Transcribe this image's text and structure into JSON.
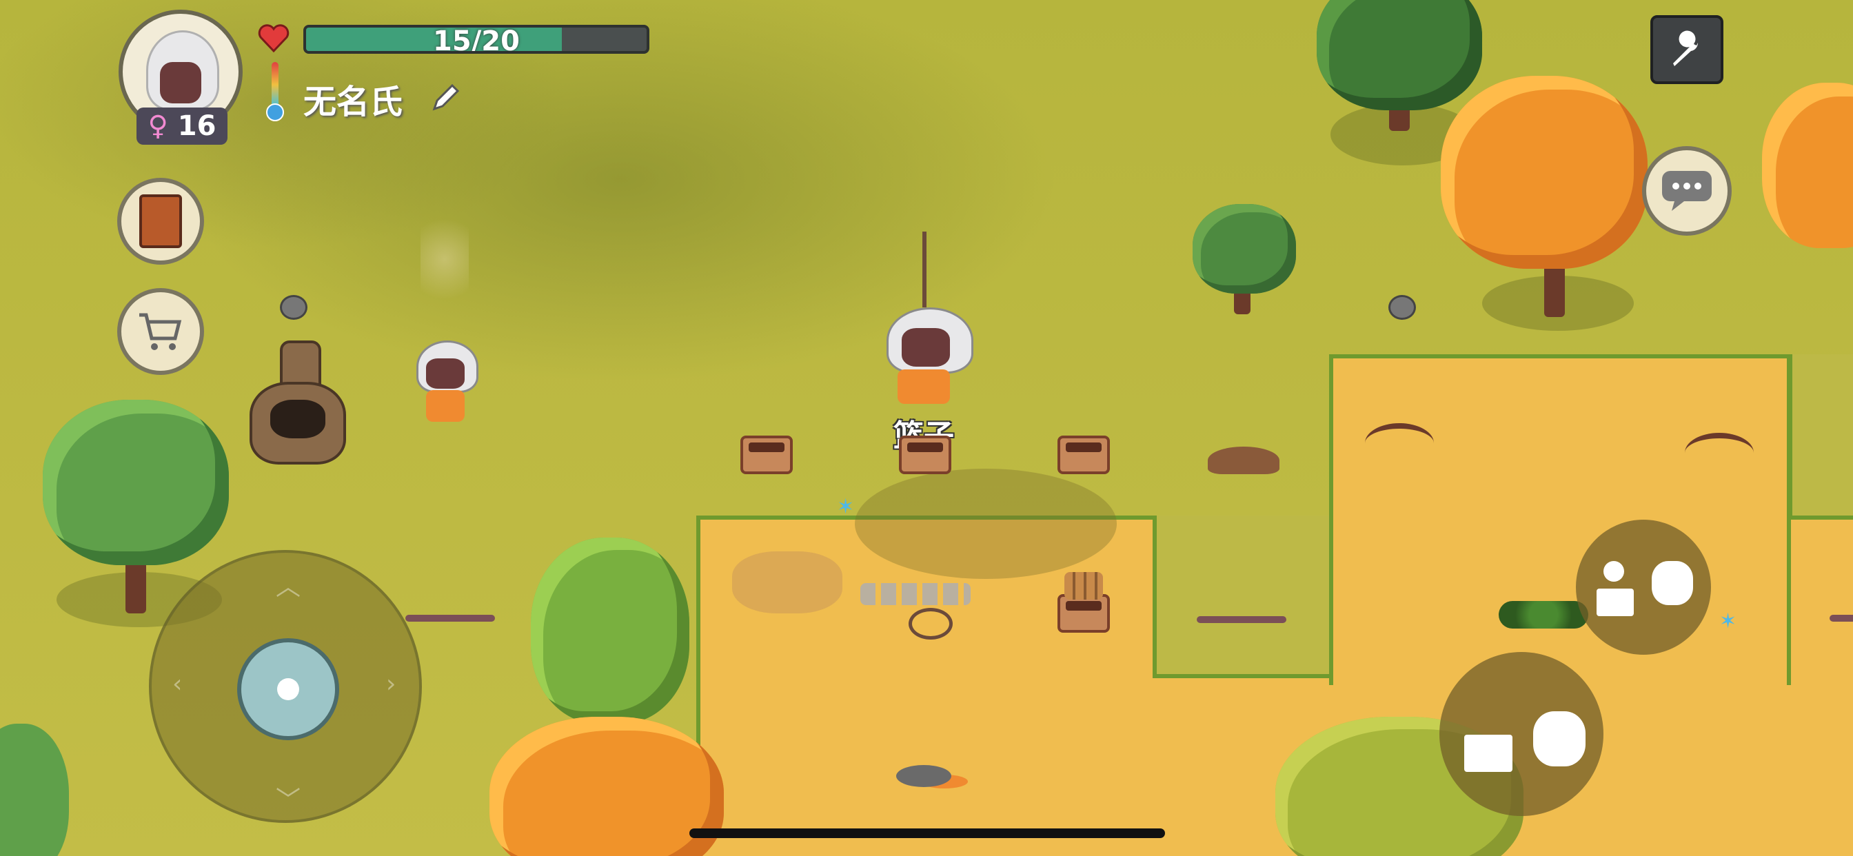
{
  "hud": {
    "health_text": "15/20",
    "health_fraction": 0.75,
    "player_name": "无名氏",
    "age": "16",
    "gender_symbol": "♀"
  },
  "scene": {
    "held_item_label": "篮子"
  },
  "colors": {
    "health_fill": "#3fa07a",
    "sand": "#f0bd4f",
    "grass": "#b9b53f"
  },
  "icons": {
    "heart": "heart-icon",
    "thermometer": "thermometer-icon",
    "edit": "pencil-icon",
    "journal": "book-icon",
    "shop": "cart-icon",
    "settings": "wrench-icon",
    "chat": "chat-bubble-icon"
  }
}
